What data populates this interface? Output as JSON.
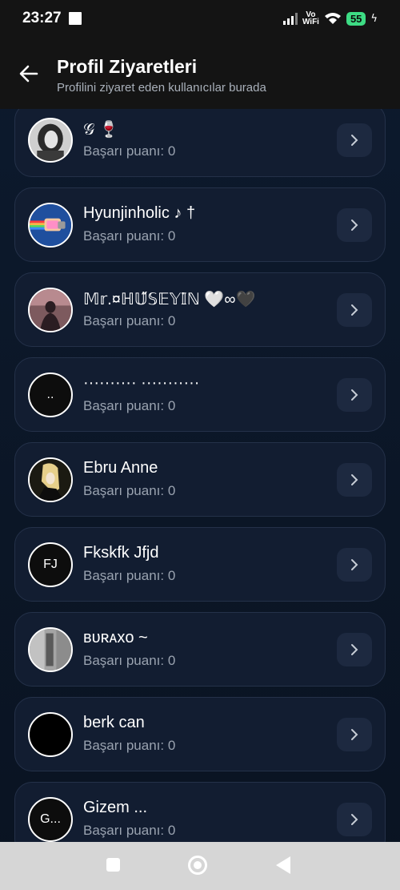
{
  "status_bar": {
    "time": "23:27",
    "network": "Vo\nWiFi",
    "battery": "55"
  },
  "header": {
    "title": "Profil Ziyaretleri",
    "subtitle": "Profilini ziyaret eden kullanıcılar burada"
  },
  "visitors": [
    {
      "name": "𝒢 🍷",
      "score": "Başarı puanı: 0",
      "avatar": "photo-woman"
    },
    {
      "name": "Hyunjinholic ♪ †",
      "score": "Başarı puanı: 0",
      "avatar": "nyan-cat"
    },
    {
      "name": "𝕄𝕣.¤ℍ𝕌̋𝕊𝔼𝕐𝕀̇ℕ 🤍∞🖤",
      "score": "Başarı puanı: 0",
      "avatar": "photo-silhouette"
    },
    {
      "name": "·········· ···········",
      "score": "Başarı puanı: 0",
      "avatar_text": ".."
    },
    {
      "name": "Ebru Anne",
      "score": "Başarı puanı: 0",
      "avatar": "photo-anime"
    },
    {
      "name": "Fkskfk Jfjd",
      "score": "Başarı puanı: 0",
      "avatar_text": "FJ"
    },
    {
      "name": "ʙᴜʀᴀxᴏ ~",
      "score": "Başarı puanı: 0",
      "avatar": "photo-texture"
    },
    {
      "name": "berk can",
      "score": "Başarı puanı: 0",
      "avatar": "black"
    },
    {
      "name": "Gizem ...",
      "score": "Başarı puanı: 0",
      "avatar_text": "G..."
    }
  ],
  "colors": {
    "background": "#0b1626",
    "card": "#121d31",
    "card_border": "#243149",
    "button": "#1d2940",
    "muted_text": "#9aa3b0"
  }
}
